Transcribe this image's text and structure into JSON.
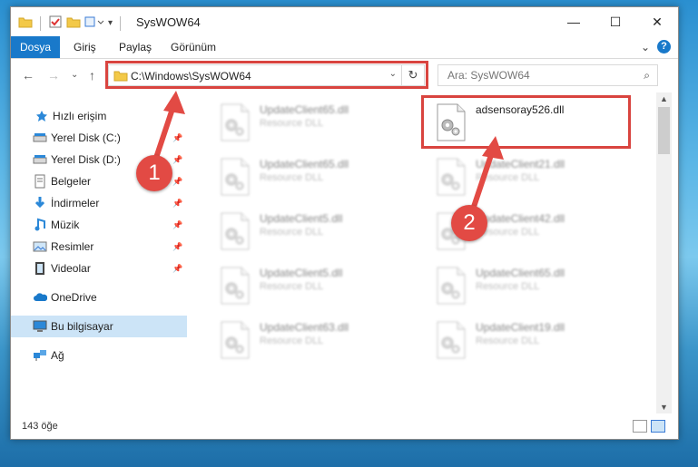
{
  "window": {
    "title": "SysWOW64",
    "controls": {
      "minimize": "—",
      "maximize": "☐",
      "close": "✕"
    }
  },
  "ribbon": {
    "tabs": [
      "Dosya",
      "Giriş",
      "Paylaş",
      "Görünüm"
    ],
    "help": "?",
    "collapse": "⌄"
  },
  "navigation": {
    "back": "←",
    "forward": "→",
    "recent": "⌄",
    "up": "↑",
    "address": "C:\\Windows\\SysWOW64",
    "address_dropdown": "⌄",
    "refresh": "↻",
    "search_placeholder": "Ara: SysWOW64",
    "search_icon_glyph": "⌕"
  },
  "sidebar": {
    "items": [
      {
        "label": "Hızlı erişim",
        "icon": "star-icon",
        "pin": ""
      },
      {
        "label": "Yerel Disk (C:)",
        "icon": "drive-icon",
        "pin": "📌"
      },
      {
        "label": "Yerel Disk (D:)",
        "icon": "drive-icon",
        "pin": "📌"
      },
      {
        "label": "Belgeler",
        "icon": "documents-icon",
        "pin": "📌"
      },
      {
        "label": "İndirmeler",
        "icon": "download-icon",
        "pin": "📌"
      },
      {
        "label": "Müzik",
        "icon": "music-icon",
        "pin": "📌"
      },
      {
        "label": "Resimler",
        "icon": "pictures-icon",
        "pin": "📌"
      },
      {
        "label": "Videolar",
        "icon": "videos-icon",
        "pin": "📌"
      },
      {
        "label": "OneDrive",
        "icon": "onedrive-icon",
        "pin": ""
      },
      {
        "label": "Bu bilgisayar",
        "icon": "computer-icon",
        "pin": ""
      },
      {
        "label": "Ağ",
        "icon": "network-icon",
        "pin": ""
      }
    ],
    "selected": "Bu bilgisayar"
  },
  "files": [
    {
      "name": "UpdateClient65.dll",
      "type": "Resource DLL"
    },
    {
      "name": "adsensoray526.dll",
      "type": ""
    },
    {
      "name": "UpdateClient65.dll",
      "type": "Resource DLL"
    },
    {
      "name": "UpdateClient21.dll",
      "type": "Resource DLL"
    },
    {
      "name": "UpdateClient5.dll",
      "type": "Resource DLL"
    },
    {
      "name": "UpdateClient42.dll",
      "type": "Resource DLL"
    },
    {
      "name": "UpdateClient5.dll",
      "type": "Resource DLL"
    },
    {
      "name": "UpdateClient65.dll",
      "type": "Resource DLL"
    },
    {
      "name": "UpdateClient63.dll",
      "type": "Resource DLL"
    },
    {
      "name": "UpdateClient19.dll",
      "type": "Resource DLL"
    }
  ],
  "status": {
    "item_count": "143 öğe"
  },
  "annotations": {
    "callout_1": "1",
    "callout_2": "2"
  },
  "colors": {
    "accent": "#1979ca",
    "highlight": "#d9443f",
    "selection": "#cce4f7"
  }
}
